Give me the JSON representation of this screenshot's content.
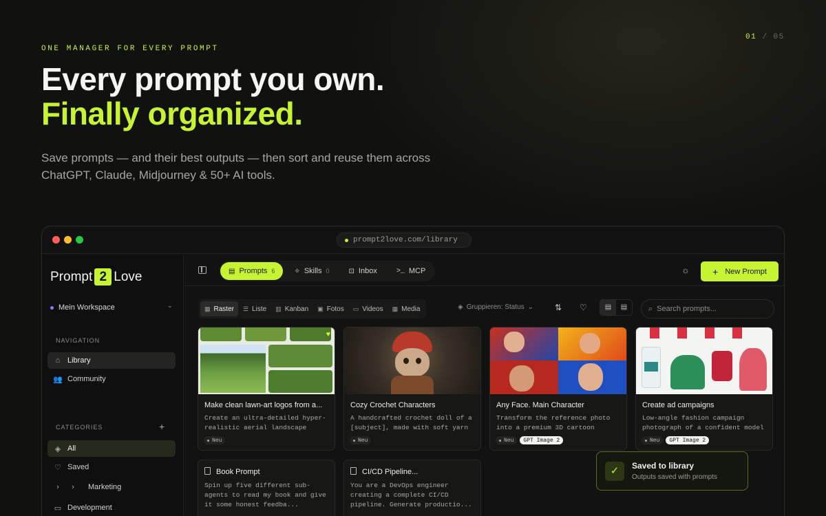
{
  "hero": {
    "eyebrow": "ONE MANAGER FOR EVERY PROMPT",
    "pager_current": "01",
    "pager_sep": "/",
    "pager_total": "05",
    "headline_1": "Every prompt you own.",
    "headline_2": "Finally organized.",
    "subtitle": "Save prompts — and their best outputs — then sort and reuse them across ChatGPT, Claude, Midjourney & 50+ AI tools."
  },
  "browser": {
    "url": "prompt2love.com/library"
  },
  "colors": {
    "accent": "#c6f432",
    "background": "#111110",
    "workspace_dot": "#8b7cf6"
  },
  "sidebar": {
    "logo_left": "Prompt",
    "logo_mid": "2",
    "logo_right": "Love",
    "workspace": "Mein Workspace",
    "nav_heading": "NAVIGATION",
    "nav": [
      {
        "label": "Library",
        "icon": "home-icon"
      },
      {
        "label": "Community",
        "icon": "users-icon"
      }
    ],
    "cat_heading": "CATEGORIES",
    "categories": [
      {
        "label": "All",
        "icon": "layers-icon"
      },
      {
        "label": "Saved",
        "icon": "heart-icon"
      },
      {
        "label": "Marketing",
        "icon": "chevron-right-icon"
      },
      {
        "label": "Development",
        "icon": "folder-icon"
      }
    ]
  },
  "topbar": {
    "tabs": [
      {
        "label": "Prompts",
        "count": "6"
      },
      {
        "label": "Skills",
        "count": "0"
      },
      {
        "label": "Inbox",
        "count": ""
      },
      {
        "label": "MCP",
        "count": ""
      }
    ],
    "new_prompt": "New Prompt"
  },
  "toolbar": {
    "views": [
      "Raster",
      "Liste",
      "Kanban",
      "Fotos",
      "Videos",
      "Media"
    ],
    "group_label": "Gruppieren: Status",
    "search_placeholder": "Search prompts..."
  },
  "cards": [
    {
      "title": "Make clean lawn-art logos from a...",
      "desc": "Create an ultra-detailed hyper-realistic aerial landscape",
      "tags": [
        "Neu"
      ],
      "image": "lawn-art-thumbnail"
    },
    {
      "title": "Cozy Crochet Characters",
      "desc": "A handcrafted crochet doll of a [subject], made with soft yarn",
      "tags": [
        "Neu"
      ],
      "image": "crochet-doll-thumbnail"
    },
    {
      "title": "Any Face. Main Character",
      "desc": "Transform the reference photo into a premium 3D cartoon",
      "tags": [
        "Neu",
        "GPT Image 2"
      ],
      "image": "cartoon-faces-thumbnail"
    },
    {
      "title": "Create ad campaigns",
      "desc": "Low-angle fashion campaign photograph of a confident model",
      "tags": [
        "Neu",
        "GPT Image 2"
      ],
      "image": "fashion-ad-thumbnail"
    },
    {
      "title": "Book Prompt",
      "desc": "Spin up five different sub-agents to read my book and give it some honest feedba...",
      "tags": [],
      "image": ""
    },
    {
      "title": "CI/CD Pipeline...",
      "desc": "You are a DevOps engineer creating a complete CI/CD pipeline. Generate productio...",
      "tags": [],
      "image": ""
    }
  ],
  "toast": {
    "title": "Saved to library",
    "subtitle": "Outputs saved with prompts"
  }
}
